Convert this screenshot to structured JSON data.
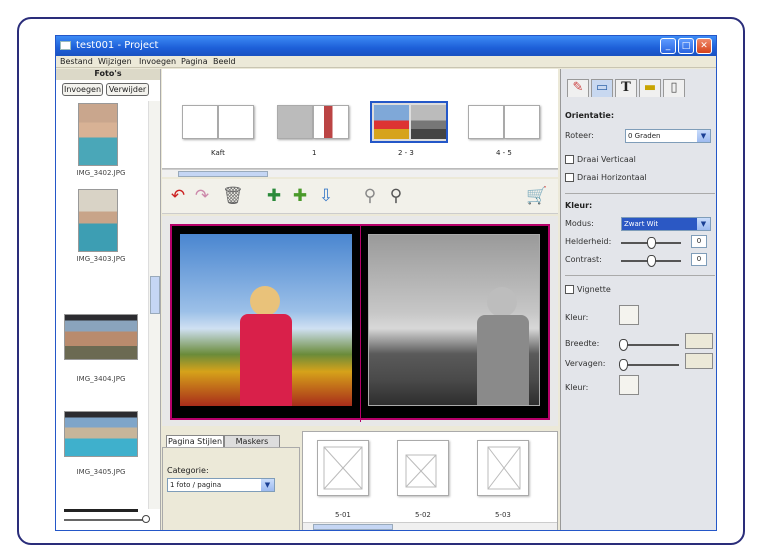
{
  "window": {
    "title": "test001 - Project",
    "minimize": "_",
    "maximize": "□",
    "close": "✕"
  },
  "menu": [
    "Bestand",
    "Wijzigen",
    "Invoegen",
    "Pagina",
    "Beeld"
  ],
  "photos_panel": {
    "title": "Foto's",
    "insert_button": "Invoegen",
    "remove_button": "Verwijder",
    "thumbnails": [
      "IMG_3402.JPG",
      "IMG_3403.JPG",
      "IMG_3404.JPG",
      "IMG_3405.JPG"
    ]
  },
  "pages": {
    "items": [
      {
        "label": "Kaft"
      },
      {
        "label": "1"
      },
      {
        "label": "2 - 3"
      },
      {
        "label": "4 - 5"
      }
    ]
  },
  "toolbar": {
    "icons": [
      "rotate-left-icon",
      "rotate-right-icon",
      "delete-icon",
      "add-page-icon",
      "add-spread-icon",
      "import-icon",
      "zoom-out-icon",
      "zoom-in-icon",
      "cart-icon"
    ]
  },
  "bottom_tabs": {
    "tab1": "Pagina Stijlen",
    "tab2": "Maskers"
  },
  "category": {
    "label": "Categorie:",
    "value": "1 foto / pagina"
  },
  "layouts": [
    "5-01",
    "5-02",
    "5-03"
  ],
  "right_panel": {
    "tabs": [
      "photo-edit-icon",
      "frame-icon",
      "text-icon",
      "ruler-icon",
      "page-icon"
    ],
    "rotation": {
      "heading": "Orientatie:",
      "label": "Roteer:",
      "value": "0 Graden",
      "flip_v": "Draai Verticaal",
      "flip_h": "Draai Horizontaal"
    },
    "color": {
      "heading": "Kleur:",
      "mode_label": "Modus:",
      "mode_value": "Zwart Wit",
      "brightness_label": "Helderheid:",
      "brightness_value": "0",
      "contrast_label": "Contrast:",
      "contrast_value": "0"
    },
    "vignette": {
      "label": "Vignette",
      "color_label": "Kleur:",
      "width_label": "Breedte:",
      "fade_label": "Vervagen:",
      "color2_label": "Kleur:"
    }
  },
  "colors": {
    "accent": "#2a2d7a",
    "titlebar": "#1d5fd8",
    "spread_border": "#b7006a"
  }
}
